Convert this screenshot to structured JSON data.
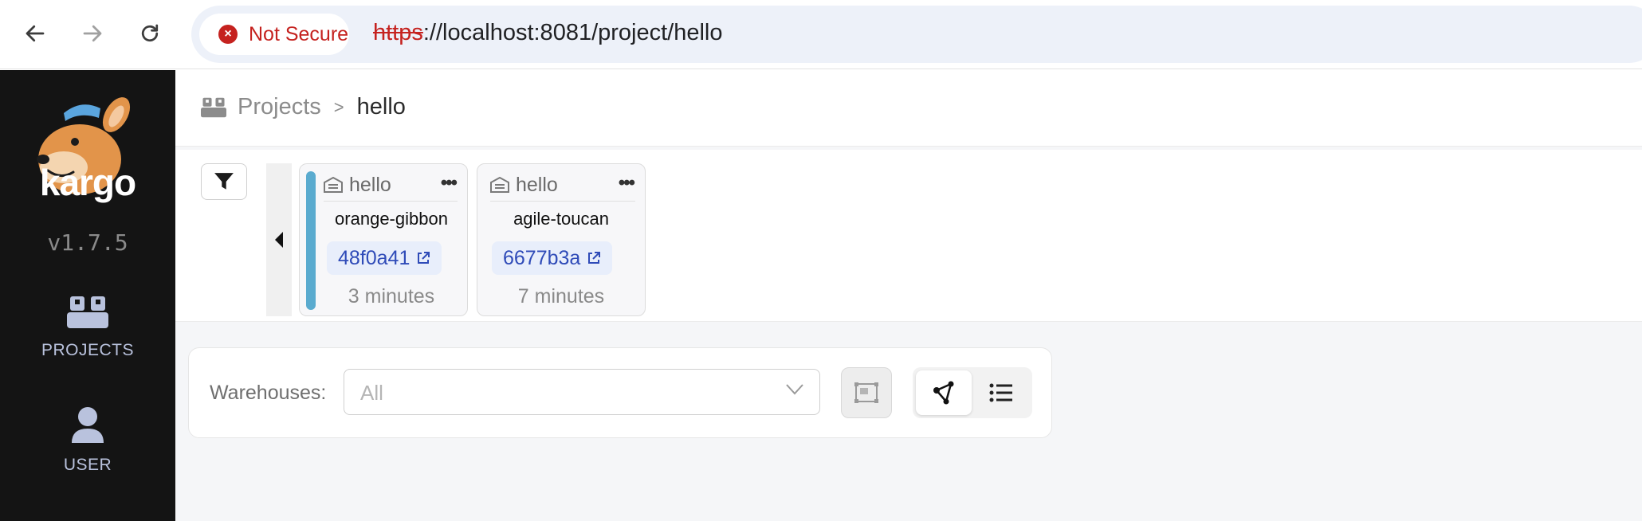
{
  "browser": {
    "security_label": "Not Secure",
    "url_scheme": "https",
    "url_rest": "://localhost:8081/project/hello"
  },
  "sidebar": {
    "brand": "kargo",
    "version": "v1.7.5",
    "items": [
      {
        "label": "PROJECTS",
        "icon": "projects-icon"
      },
      {
        "label": "USER",
        "icon": "user-icon"
      }
    ]
  },
  "breadcrumb": {
    "root": "Projects",
    "separator": ">",
    "current": "hello"
  },
  "stages": [
    {
      "warehouse": "hello",
      "freight": "orange-gibbon",
      "commit": "48f0a41",
      "age": "3 minutes",
      "accent_color": "#5aabcf"
    },
    {
      "warehouse": "hello",
      "freight": "agile-toucan",
      "commit": "6677b3a",
      "age": "7 minutes"
    }
  ],
  "warehouse_filter": {
    "label": "Warehouses:",
    "placeholder": "All"
  },
  "colors": {
    "sidebar_bg": "#141414",
    "insecure_red": "#c5221f",
    "commit_link": "#2f4bb8"
  }
}
